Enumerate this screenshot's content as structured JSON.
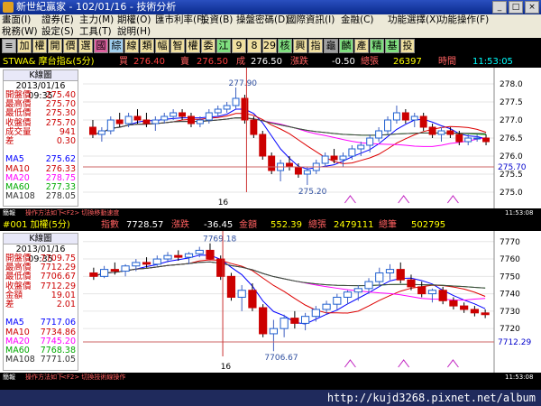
{
  "titlebar": {
    "title": "新世紀贏家 - 102/01/16 - 技術分析",
    "window_buttons": [
      "_",
      "□",
      "×"
    ]
  },
  "menu": {
    "row1": [
      "畫面(I)",
      "證券(E)",
      "主力(M)",
      "期權(O)",
      "匯市利率(F)",
      "投資(B)",
      "操盤密碼(D)",
      "國際資訊(I)",
      "金融(C)",
      "功能選擇(X)",
      "功能操作(F)"
    ],
    "row2": [
      "稅務(W)",
      "設定(S)",
      "工具(T)",
      "說明(H)"
    ]
  },
  "toolbar": {
    "buttons": [
      "加",
      "權",
      "開",
      "價",
      "選",
      "國",
      "綜",
      "線",
      "類",
      "幅",
      "智",
      "權",
      "委",
      "江",
      "9",
      "8",
      "29",
      "核",
      "興",
      "指",
      "龜",
      "麟",
      "產",
      "精",
      "基",
      "投"
    ],
    "colors": [
      "#f0e0a0",
      "#f0e0a0",
      "#f0e0a0",
      "#f0e0a0",
      "#f0e0a0",
      "#e060a0",
      "#a0d0f0",
      "#f0e0a0",
      "#f0e0a0",
      "#f0e0a0",
      "#f0e0a0",
      "#f0e0a0",
      "#f0e0a0",
      "#80e080",
      "#f0e0a0",
      "#f0e0a0",
      "#f0e0a0",
      "#80e080",
      "#f0e0a0",
      "#f0e0a0",
      "#a0a0a0",
      "#80e080",
      "#f0e0a0",
      "#80e080",
      "#80e080",
      "#f0e0a0"
    ]
  },
  "panel1": {
    "header": {
      "symbol": "STWA& 摩台指&(5分)",
      "buy_label": "買",
      "buy": "276.40",
      "sell_label": "賣",
      "sell": "276.50",
      "deal_label": "成",
      "deal": "276.50",
      "chg_label": "漲跌",
      "chg": "-0.50",
      "vol_label": "總張",
      "vol": "26397",
      "time_label": "時間",
      "time": "11:53:05"
    },
    "info": {
      "title": "K線圖",
      "date": "2013/01/16 09:35",
      "rows": [
        {
          "k": "開盤價",
          "v": "275.40",
          "c": "#cc0000"
        },
        {
          "k": "最高價",
          "v": "275.70",
          "c": "#cc0000"
        },
        {
          "k": "最低價",
          "v": "275.30",
          "c": "#cc0000"
        },
        {
          "k": "收盤價",
          "v": "275.70",
          "c": "#cc0000"
        },
        {
          "k": "成交量",
          "v": "941",
          "c": "#cc0000"
        },
        {
          "k": "差",
          "v": "0.30",
          "c": "#cc0000"
        },
        {
          "k": "",
          "v": "",
          "c": "#000"
        },
        {
          "k": "MA5",
          "v": "275.62",
          "c": "#0000ff"
        },
        {
          "k": "MA10",
          "v": "276.33",
          "c": "#cc0000"
        },
        {
          "k": "MA20",
          "v": "278.75",
          "c": "#ff00ff"
        },
        {
          "k": "MA60",
          "v": "277.33",
          "c": "#00aa00"
        },
        {
          "k": "MA108",
          "v": "278.05",
          "c": "#333333"
        }
      ]
    },
    "status": {
      "left": "簡報",
      "right_a": "操作方法如下",
      "right_b": "<F2> 切換移動速度",
      "time": "11:53:08"
    },
    "chart_data": {
      "type": "candlestick",
      "yaxis": [
        "278.0",
        "277.5",
        "277.0",
        "276.5",
        "276.0",
        "275.5",
        "275.0"
      ],
      "ylim": [
        275.0,
        278.3
      ],
      "x_tick_label": "16",
      "high_label": "277.90",
      "low_label": "275.20",
      "current_label": "275.70",
      "current_price": 275.7,
      "candles": [
        [
          276.8,
          277.0,
          276.5,
          276.6
        ],
        [
          276.6,
          276.8,
          276.4,
          276.7
        ],
        [
          276.7,
          277.1,
          276.6,
          277.0
        ],
        [
          277.0,
          277.2,
          276.8,
          276.9
        ],
        [
          276.9,
          277.2,
          276.8,
          277.1
        ],
        [
          277.1,
          277.3,
          276.9,
          277.0
        ],
        [
          277.0,
          277.2,
          276.8,
          276.9
        ],
        [
          276.9,
          277.1,
          276.7,
          277.0
        ],
        [
          277.0,
          277.2,
          276.9,
          277.1
        ],
        [
          277.1,
          277.3,
          277.0,
          277.2
        ],
        [
          277.2,
          277.3,
          277.0,
          277.1
        ],
        [
          277.1,
          277.2,
          276.8,
          276.9
        ],
        [
          276.9,
          277.1,
          276.8,
          277.0
        ],
        [
          277.0,
          277.3,
          276.9,
          277.2
        ],
        [
          277.2,
          277.4,
          277.1,
          277.3
        ],
        [
          277.3,
          277.5,
          277.2,
          277.4
        ],
        [
          277.4,
          277.9,
          277.3,
          277.6
        ],
        [
          277.6,
          277.7,
          276.9,
          277.0
        ],
        [
          277.0,
          277.1,
          276.5,
          276.6
        ],
        [
          276.6,
          276.7,
          275.9,
          276.0
        ],
        [
          276.0,
          276.1,
          275.5,
          275.6
        ],
        [
          275.6,
          275.9,
          275.3,
          275.8
        ],
        [
          275.8,
          276.0,
          275.6,
          275.7
        ],
        [
          275.7,
          275.8,
          275.4,
          275.5
        ],
        [
          275.5,
          275.7,
          275.2,
          275.6
        ],
        [
          275.6,
          275.9,
          275.5,
          275.8
        ],
        [
          275.8,
          276.1,
          275.7,
          276.0
        ],
        [
          276.0,
          276.2,
          275.8,
          275.9
        ],
        [
          275.9,
          276.1,
          275.7,
          276.0
        ],
        [
          276.0,
          276.3,
          275.9,
          276.2
        ],
        [
          276.2,
          276.4,
          276.0,
          276.3
        ],
        [
          276.3,
          276.6,
          276.1,
          276.5
        ],
        [
          276.5,
          276.8,
          276.4,
          276.7
        ],
        [
          276.7,
          277.1,
          276.6,
          277.0
        ],
        [
          277.0,
          277.4,
          276.9,
          277.2
        ],
        [
          277.2,
          277.3,
          276.9,
          277.0
        ],
        [
          277.0,
          277.2,
          276.8,
          277.1
        ],
        [
          277.1,
          277.2,
          276.7,
          276.8
        ],
        [
          276.8,
          276.9,
          276.5,
          276.6
        ],
        [
          276.6,
          276.8,
          276.4,
          276.7
        ],
        [
          276.7,
          276.8,
          276.5,
          276.6
        ],
        [
          276.6,
          276.7,
          276.3,
          276.4
        ],
        [
          276.4,
          276.6,
          276.3,
          276.5
        ],
        [
          276.5,
          276.6,
          276.4,
          276.5
        ],
        [
          276.5,
          276.6,
          276.3,
          276.4
        ]
      ]
    }
  },
  "panel2": {
    "header": {
      "symbol": "#001 加權(5分)",
      "idx_label": "指數",
      "idx": "7728.57",
      "chg_label": "漲跌",
      "chg": "-36.45",
      "amt_label": "金額",
      "amt": "552.39",
      "vol_label": "總張",
      "vol": "2479111",
      "cnt_label": "總筆",
      "cnt": "502795"
    },
    "info": {
      "title": "K線圖",
      "date": "2013/01/16 09:35",
      "rows": [
        {
          "k": "開盤價",
          "v": "7709.75",
          "c": "#cc0000"
        },
        {
          "k": "最高價",
          "v": "7712.29",
          "c": "#cc0000"
        },
        {
          "k": "最低價",
          "v": "7706.67",
          "c": "#cc0000"
        },
        {
          "k": "收盤價",
          "v": "7712.29",
          "c": "#cc0000"
        },
        {
          "k": "金額",
          "v": "19.01",
          "c": "#cc0000"
        },
        {
          "k": "差",
          "v": "2.01",
          "c": "#cc0000"
        },
        {
          "k": "",
          "v": "",
          "c": "#000"
        },
        {
          "k": "MA5",
          "v": "7717.06",
          "c": "#0000ff"
        },
        {
          "k": "MA10",
          "v": "7734.86",
          "c": "#cc0000"
        },
        {
          "k": "MA20",
          "v": "7745.20",
          "c": "#ff00ff"
        },
        {
          "k": "MA60",
          "v": "7768.38",
          "c": "#00aa00"
        },
        {
          "k": "MA108",
          "v": "7771.05",
          "c": "#333333"
        }
      ]
    },
    "status": {
      "left": "簡報",
      "right_a": "操作方法如下",
      "right_b": "<F2> 切換技術線操作",
      "time": "11:53:08"
    },
    "chart_data": {
      "type": "candlestick",
      "yaxis": [
        "7770",
        "7760",
        "7750",
        "7740",
        "7730",
        "7720"
      ],
      "ylim": [
        7704,
        7773
      ],
      "x_tick_label": "16",
      "high_label": "7769.18",
      "low_label": "7706.67",
      "current_label": "7712.29",
      "current_price": 7712.29,
      "candles": [
        [
          7752,
          7755,
          7748,
          7750
        ],
        [
          7750,
          7756,
          7749,
          7754
        ],
        [
          7754,
          7758,
          7751,
          7753
        ],
        [
          7753,
          7757,
          7750,
          7756
        ],
        [
          7756,
          7760,
          7753,
          7758
        ],
        [
          7758,
          7761,
          7755,
          7757
        ],
        [
          7757,
          7762,
          7756,
          7760
        ],
        [
          7760,
          7764,
          7758,
          7762
        ],
        [
          7762,
          7765,
          7759,
          7761
        ],
        [
          7761,
          7764,
          7757,
          7763
        ],
        [
          7763,
          7767,
          7761,
          7765
        ],
        [
          7765,
          7769,
          7762,
          7760
        ],
        [
          7760,
          7762,
          7748,
          7750
        ],
        [
          7750,
          7752,
          7736,
          7738
        ],
        [
          7738,
          7745,
          7730,
          7742
        ],
        [
          7742,
          7746,
          7730,
          7732
        ],
        [
          7732,
          7734,
          7715,
          7717
        ],
        [
          7717,
          7725,
          7707,
          7720
        ],
        [
          7720,
          7728,
          7715,
          7726
        ],
        [
          7726,
          7730,
          7720,
          7723
        ],
        [
          7723,
          7729,
          7719,
          7727
        ],
        [
          7727,
          7733,
          7724,
          7731
        ],
        [
          7731,
          7736,
          7728,
          7734
        ],
        [
          7734,
          7740,
          7731,
          7738
        ],
        [
          7738,
          7742,
          7734,
          7741
        ],
        [
          7741,
          7745,
          7736,
          7743
        ],
        [
          7743,
          7749,
          7740,
          7747
        ],
        [
          7747,
          7755,
          7744,
          7752
        ],
        [
          7752,
          7757,
          7748,
          7754
        ],
        [
          7754,
          7758,
          7746,
          7748
        ],
        [
          7748,
          7751,
          7742,
          7744
        ],
        [
          7744,
          7747,
          7738,
          7740
        ],
        [
          7740,
          7743,
          7735,
          7742
        ],
        [
          7742,
          7744,
          7734,
          7736
        ],
        [
          7736,
          7738,
          7731,
          7733
        ],
        [
          7733,
          7735,
          7729,
          7731
        ],
        [
          7731,
          7733,
          7727,
          7729
        ],
        [
          7729,
          7731,
          7726,
          7728
        ]
      ]
    }
  },
  "taskbar": {
    "url": "http://kujd3268.pixnet.net/album"
  }
}
